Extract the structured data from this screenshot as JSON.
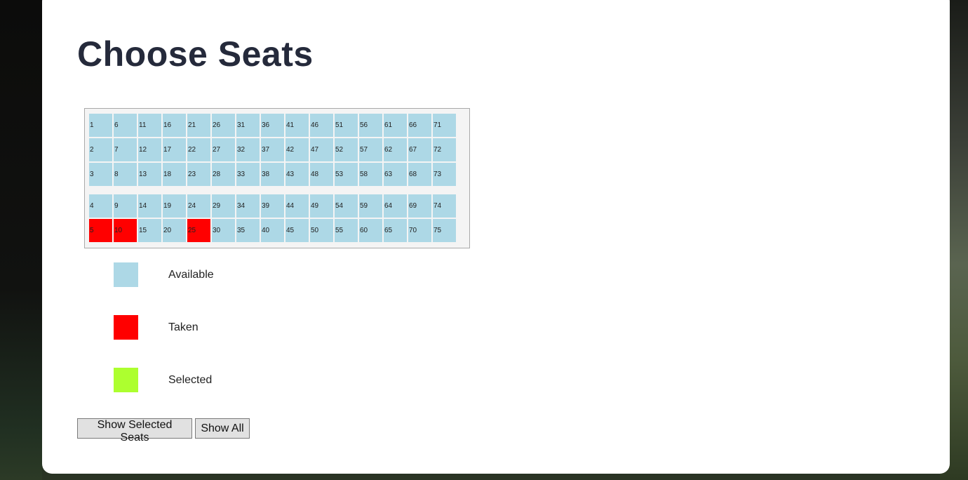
{
  "page": {
    "title": "Choose Seats"
  },
  "seat_map": {
    "colors": {
      "available": "#add8e6",
      "taken": "#ff0000",
      "selected": "#adff2f"
    },
    "seats": [
      {
        "number": "1",
        "status": "available"
      },
      {
        "number": "2",
        "status": "available"
      },
      {
        "number": "3",
        "status": "available"
      },
      {
        "number": "4",
        "status": "available"
      },
      {
        "number": "5",
        "status": "taken"
      },
      {
        "number": "6",
        "status": "available"
      },
      {
        "number": "7",
        "status": "available"
      },
      {
        "number": "8",
        "status": "available"
      },
      {
        "number": "9",
        "status": "available"
      },
      {
        "number": "10",
        "status": "taken"
      },
      {
        "number": "11",
        "status": "available"
      },
      {
        "number": "12",
        "status": "available"
      },
      {
        "number": "13",
        "status": "available"
      },
      {
        "number": "14",
        "status": "available"
      },
      {
        "number": "15",
        "status": "available"
      },
      {
        "number": "16",
        "status": "available"
      },
      {
        "number": "17",
        "status": "available"
      },
      {
        "number": "18",
        "status": "available"
      },
      {
        "number": "19",
        "status": "available"
      },
      {
        "number": "20",
        "status": "available"
      },
      {
        "number": "21",
        "status": "available"
      },
      {
        "number": "22",
        "status": "available"
      },
      {
        "number": "23",
        "status": "available"
      },
      {
        "number": "24",
        "status": "available"
      },
      {
        "number": "25",
        "status": "taken"
      },
      {
        "number": "26",
        "status": "available"
      },
      {
        "number": "27",
        "status": "available"
      },
      {
        "number": "28",
        "status": "available"
      },
      {
        "number": "29",
        "status": "available"
      },
      {
        "number": "30",
        "status": "available"
      },
      {
        "number": "31",
        "status": "available"
      },
      {
        "number": "32",
        "status": "available"
      },
      {
        "number": "33",
        "status": "available"
      },
      {
        "number": "34",
        "status": "available"
      },
      {
        "number": "35",
        "status": "available"
      },
      {
        "number": "36",
        "status": "available"
      },
      {
        "number": "37",
        "status": "available"
      },
      {
        "number": "38",
        "status": "available"
      },
      {
        "number": "39",
        "status": "available"
      },
      {
        "number": "40",
        "status": "available"
      },
      {
        "number": "41",
        "status": "available"
      },
      {
        "number": "42",
        "status": "available"
      },
      {
        "number": "43",
        "status": "available"
      },
      {
        "number": "44",
        "status": "available"
      },
      {
        "number": "45",
        "status": "available"
      },
      {
        "number": "46",
        "status": "available"
      },
      {
        "number": "47",
        "status": "available"
      },
      {
        "number": "48",
        "status": "available"
      },
      {
        "number": "49",
        "status": "available"
      },
      {
        "number": "50",
        "status": "available"
      },
      {
        "number": "51",
        "status": "available"
      },
      {
        "number": "52",
        "status": "available"
      },
      {
        "number": "53",
        "status": "available"
      },
      {
        "number": "54",
        "status": "available"
      },
      {
        "number": "55",
        "status": "available"
      },
      {
        "number": "56",
        "status": "available"
      },
      {
        "number": "57",
        "status": "available"
      },
      {
        "number": "58",
        "status": "available"
      },
      {
        "number": "59",
        "status": "available"
      },
      {
        "number": "60",
        "status": "available"
      },
      {
        "number": "61",
        "status": "available"
      },
      {
        "number": "62",
        "status": "available"
      },
      {
        "number": "63",
        "status": "available"
      },
      {
        "number": "64",
        "status": "available"
      },
      {
        "number": "65",
        "status": "available"
      },
      {
        "number": "66",
        "status": "available"
      },
      {
        "number": "67",
        "status": "available"
      },
      {
        "number": "68",
        "status": "available"
      },
      {
        "number": "69",
        "status": "available"
      },
      {
        "number": "70",
        "status": "available"
      },
      {
        "number": "71",
        "status": "available"
      },
      {
        "number": "72",
        "status": "available"
      },
      {
        "number": "73",
        "status": "available"
      },
      {
        "number": "74",
        "status": "available"
      },
      {
        "number": "75",
        "status": "available"
      }
    ]
  },
  "legend": {
    "available_label": "Available",
    "taken_label": "Taken",
    "selected_label": "Selected"
  },
  "buttons": {
    "show_selected_label": "Show Selected Seats",
    "show_all_label": "Show All"
  }
}
